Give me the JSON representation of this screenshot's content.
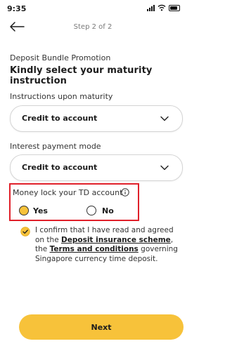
{
  "status_bar": {
    "time": "9:35"
  },
  "header": {
    "step_label": "Step 2 of 2"
  },
  "promo": {
    "label": "Deposit Bundle Promotion",
    "title": "Kindly select your maturity instruction"
  },
  "maturity": {
    "label": "Instructions upon maturity",
    "value": "Credit to account"
  },
  "interest": {
    "label": "Interest payment mode",
    "value": "Credit to account"
  },
  "money_lock": {
    "label": "Money lock your TD account",
    "options": [
      "Yes",
      "No"
    ],
    "selected": "Yes"
  },
  "consent": {
    "checked": true,
    "text_before": "I confirm that I have read and agreed on the ",
    "link_deposit": "Deposit insurance scheme",
    "text_middle": ", the ",
    "link_terms": "Terms and conditions",
    "text_after": " governing Singapore currency time deposit."
  },
  "footer": {
    "next_label": "Next"
  },
  "colors": {
    "accent": "#f7c23a",
    "highlight_border": "#e0202a"
  }
}
